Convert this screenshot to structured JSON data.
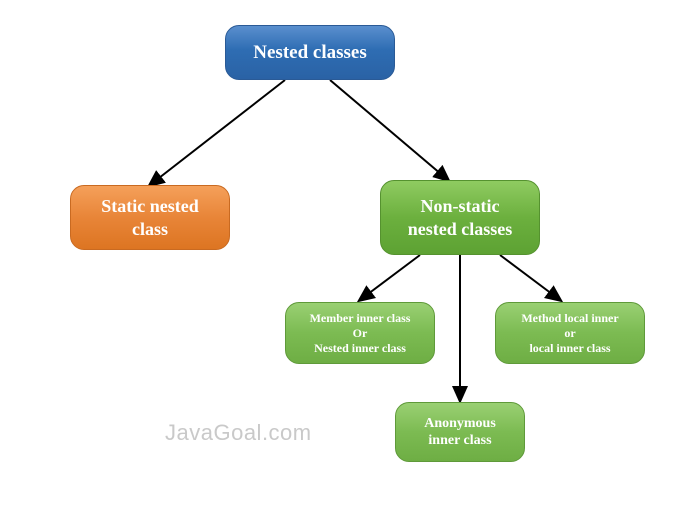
{
  "chart_data": {
    "type": "tree",
    "root": {
      "label": "Nested classes",
      "children": [
        {
          "label": "Static nested class",
          "children": []
        },
        {
          "label": "Non-static nested classes",
          "children": [
            {
              "label": "Member inner class Or Nested inner class"
            },
            {
              "label": "Anonymous inner class"
            },
            {
              "label": "Method local inner or local inner class"
            }
          ]
        }
      ]
    }
  },
  "nodes": {
    "root": "Nested classes",
    "static_nested": {
      "l1": "Static nested",
      "l2": "class"
    },
    "nonstatic": {
      "l1": "Non-static",
      "l2": "nested classes"
    },
    "member": {
      "l1": "Member inner class",
      "l2": "Or",
      "l3": "Nested inner class"
    },
    "method_local": {
      "l1": "Method local inner",
      "l2": "or",
      "l3": "local inner class"
    },
    "anonymous": {
      "l1": "Anonymous",
      "l2": "inner class"
    }
  },
  "watermark": "JavaGoal.com"
}
